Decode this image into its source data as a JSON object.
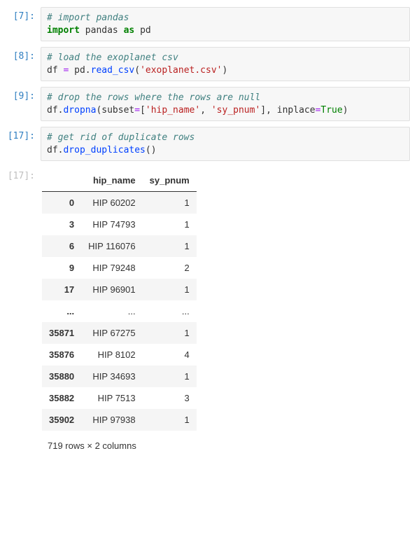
{
  "cells": [
    {
      "prompt": "[7]:",
      "lines": [
        [
          {
            "t": "# import pandas",
            "c": "c-comment"
          }
        ],
        [
          {
            "t": "import",
            "c": "c-keyword"
          },
          {
            "t": " pandas "
          },
          {
            "t": "as",
            "c": "c-keyword"
          },
          {
            "t": " pd"
          }
        ]
      ]
    },
    {
      "prompt": "[8]:",
      "lines": [
        [
          {
            "t": "# load the exoplanet csv",
            "c": "c-comment"
          }
        ],
        [
          {
            "t": "df "
          },
          {
            "t": "=",
            "c": "c-operator"
          },
          {
            "t": " pd"
          },
          {
            "t": "."
          },
          {
            "t": "read_csv",
            "c": "c-func"
          },
          {
            "t": "("
          },
          {
            "t": "'exoplanet.csv'",
            "c": "c-string"
          },
          {
            "t": ")"
          }
        ]
      ]
    },
    {
      "prompt": "[9]:",
      "lines": [
        [
          {
            "t": "# drop the rows where the rows are null",
            "c": "c-comment"
          }
        ],
        [
          {
            "t": "df"
          },
          {
            "t": "."
          },
          {
            "t": "dropna",
            "c": "c-func"
          },
          {
            "t": "(subset"
          },
          {
            "t": "=",
            "c": "c-operator"
          },
          {
            "t": "["
          },
          {
            "t": "'hip_name'",
            "c": "c-string"
          },
          {
            "t": ", "
          },
          {
            "t": "'sy_pnum'",
            "c": "c-string"
          },
          {
            "t": "], inplace"
          },
          {
            "t": "=",
            "c": "c-operator"
          },
          {
            "t": "True",
            "c": "c-builtin"
          },
          {
            "t": ")"
          }
        ]
      ]
    },
    {
      "prompt": "[17]:",
      "lines": [
        [
          {
            "t": "# get rid of duplicate rows",
            "c": "c-comment"
          }
        ],
        [
          {
            "t": "df"
          },
          {
            "t": "."
          },
          {
            "t": "drop_duplicates",
            "c": "c-func"
          },
          {
            "t": "()"
          }
        ]
      ]
    }
  ],
  "output_prompt": "[17]:",
  "table": {
    "columns": [
      "",
      "hip_name",
      "sy_pnum"
    ],
    "rows": [
      {
        "idx": "0",
        "hip": "HIP 60202",
        "pnum": "1"
      },
      {
        "idx": "3",
        "hip": "HIP 74793",
        "pnum": "1"
      },
      {
        "idx": "6",
        "hip": "HIP 116076",
        "pnum": "1"
      },
      {
        "idx": "9",
        "hip": "HIP 79248",
        "pnum": "2"
      },
      {
        "idx": "17",
        "hip": "HIP 96901",
        "pnum": "1"
      },
      {
        "idx": "...",
        "hip": "...",
        "pnum": "..."
      },
      {
        "idx": "35871",
        "hip": "HIP 67275",
        "pnum": "1"
      },
      {
        "idx": "35876",
        "hip": "HIP 8102",
        "pnum": "4"
      },
      {
        "idx": "35880",
        "hip": "HIP 34693",
        "pnum": "1"
      },
      {
        "idx": "35882",
        "hip": "HIP 7513",
        "pnum": "3"
      },
      {
        "idx": "35902",
        "hip": "HIP 97938",
        "pnum": "1"
      }
    ],
    "footer": "719 rows × 2 columns"
  }
}
